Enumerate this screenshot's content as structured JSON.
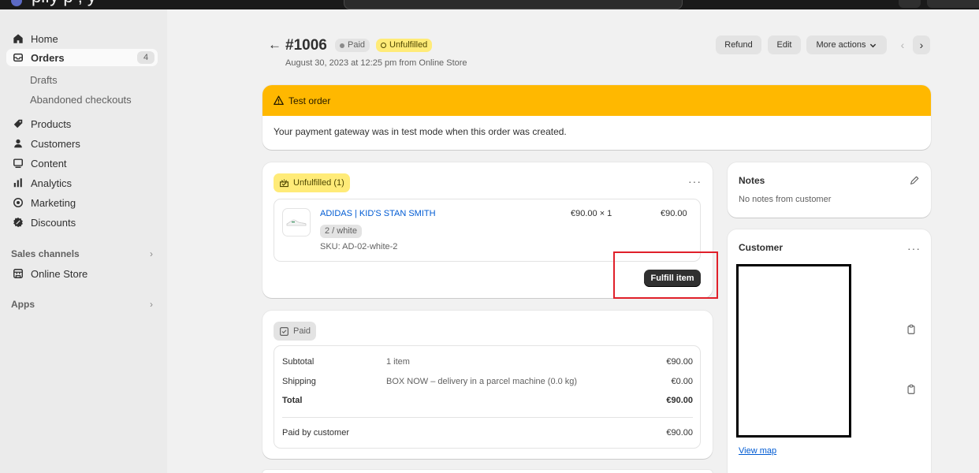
{
  "topbar": {
    "clipped_text": "pify           p        ,  y"
  },
  "sidebar": {
    "items": [
      {
        "label": "Home",
        "icon": "home-icon"
      },
      {
        "label": "Orders",
        "icon": "orders-icon",
        "badge": "4"
      },
      {
        "label": "Products",
        "icon": "tag-icon"
      },
      {
        "label": "Customers",
        "icon": "person-icon"
      },
      {
        "label": "Content",
        "icon": "content-icon"
      },
      {
        "label": "Analytics",
        "icon": "chart-icon"
      },
      {
        "label": "Marketing",
        "icon": "target-icon"
      },
      {
        "label": "Discounts",
        "icon": "discount-icon"
      }
    ],
    "order_subitems": [
      "Drafts",
      "Abandoned checkouts"
    ],
    "sales_channels": "Sales channels",
    "online_store": "Online Store",
    "apps": "Apps",
    "chevron": "›"
  },
  "header": {
    "back": "←",
    "order_number": "#1006",
    "paid_badge": "Paid",
    "unfulfilled_badge": "Unfulfilled",
    "subtitle": "August 30, 2023 at 12:25 pm from Online Store",
    "refund": "Refund",
    "edit": "Edit",
    "more_actions": "More actions",
    "prev": "‹",
    "next": "›"
  },
  "test_order": {
    "title": "Test order",
    "body": "Your payment gateway was in test mode when this order was created."
  },
  "fulfillment": {
    "status": "Unfulfilled (1)",
    "product_name": "ADIDAS | KID'S STAN SMITH",
    "variant": "2 / white",
    "sku": "SKU: AD-02-white-2",
    "unit_qty": "€90.00  ×  1",
    "line_total": "€90.00",
    "fulfill_button": "Fulfill item"
  },
  "payment": {
    "status": "Paid",
    "rows": [
      {
        "label": "Subtotal",
        "desc": "1 item",
        "value": "€90.00"
      },
      {
        "label": "Shipping",
        "desc": "BOX NOW – delivery in a parcel machine (0.0 kg)",
        "value": "€0.00"
      },
      {
        "label": "Total",
        "desc": "",
        "value": "€90.00"
      }
    ],
    "paid_by": {
      "label": "Paid by customer",
      "value": "€90.00"
    }
  },
  "notes": {
    "title": "Notes",
    "text": "No notes from customer"
  },
  "customer": {
    "title": "Customer",
    "view_map": "View map"
  },
  "ellipsis": "···",
  "colors": {
    "accent_link": "#005bd3",
    "warning": "#ffb800",
    "unfulfilled": "#ffeb78",
    "highlight": "#e0202a"
  }
}
